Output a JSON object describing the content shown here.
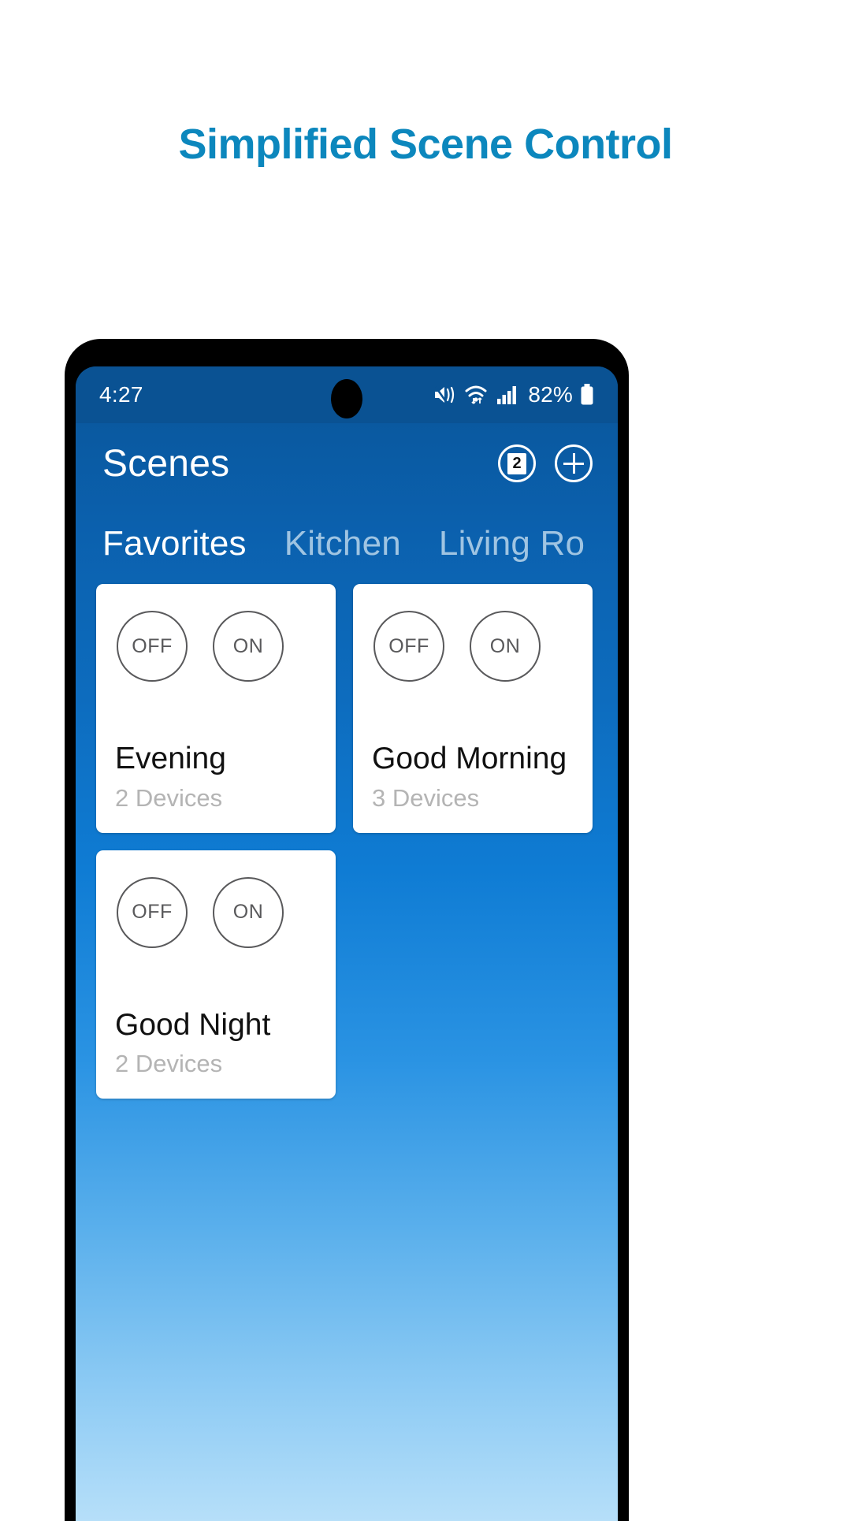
{
  "promo": {
    "headline": "Simplified Scene Control"
  },
  "phone": {
    "status_bar": {
      "time": "4:27",
      "battery_percent": "82%",
      "icons": [
        "mute-vibrate-icon",
        "wifi-icon",
        "cellular-signal-icon",
        "battery-icon"
      ]
    },
    "app_bar": {
      "title": "Scenes",
      "count_badge": "2",
      "add_button_label": "+"
    },
    "tabs": [
      {
        "label": "Favorites",
        "active": true
      },
      {
        "label": "Kitchen",
        "active": false
      },
      {
        "label": "Living Ro",
        "active": false
      }
    ],
    "scene_cards": [
      {
        "off_label": "OFF",
        "on_label": "ON",
        "name": "Evening",
        "devices": "2 Devices"
      },
      {
        "off_label": "OFF",
        "on_label": "ON",
        "name": "Good Morning",
        "devices": "3 Devices"
      },
      {
        "off_label": "OFF",
        "on_label": "ON",
        "name": "Good Night",
        "devices": "2 Devices"
      }
    ]
  },
  "colors": {
    "headline": "#0c87bd",
    "app_bar_blue": "#0a59a0",
    "status_bar_blue": "#0a5293",
    "card_white": "#ffffff",
    "device_text_gray": "#b4b4b4",
    "toggle_outline": "#59595b"
  }
}
